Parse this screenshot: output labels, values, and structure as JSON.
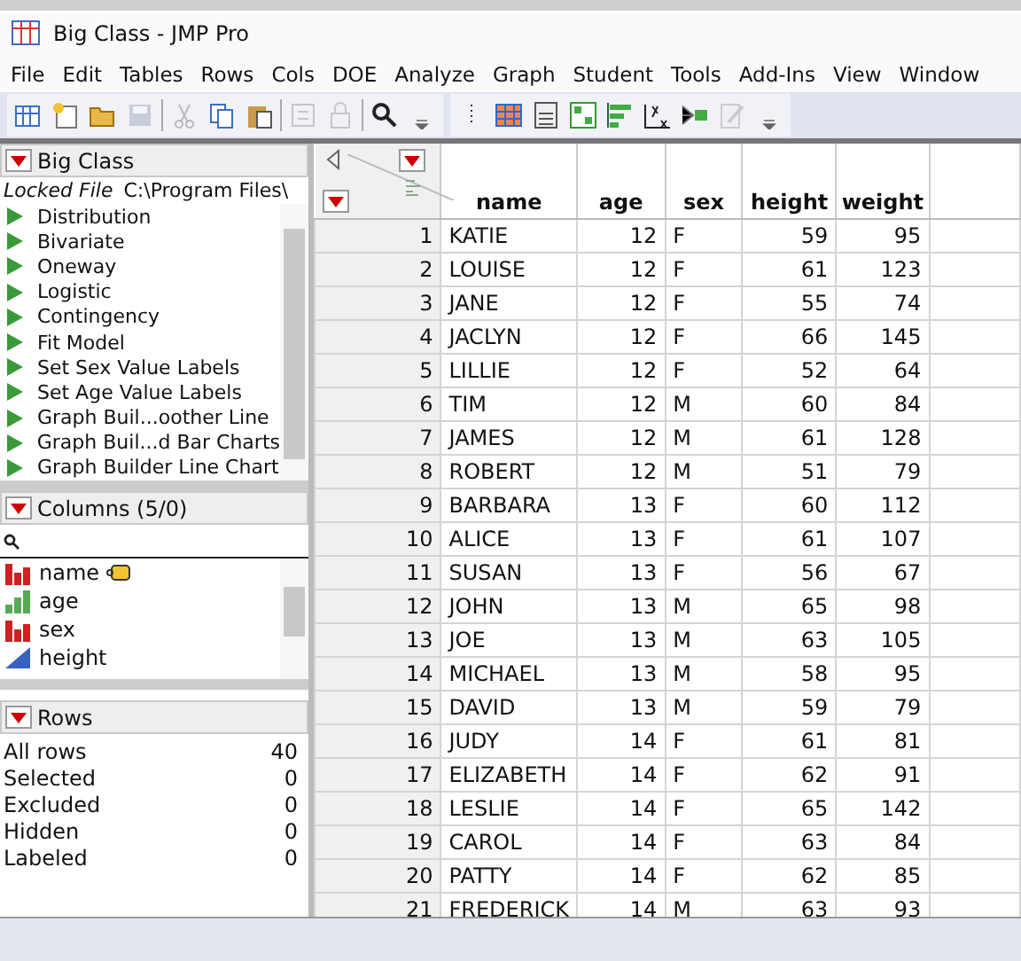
{
  "window": {
    "title": "Big Class - JMP Pro"
  },
  "menu": [
    "File",
    "Edit",
    "Tables",
    "Rows",
    "Cols",
    "DOE",
    "Analyze",
    "Graph",
    "Student",
    "Tools",
    "Add-Ins",
    "View",
    "Window"
  ],
  "toolbar": [
    {
      "kind": "new-table",
      "disabled": false
    },
    {
      "kind": "new-script",
      "disabled": false
    },
    {
      "kind": "open",
      "disabled": false
    },
    {
      "kind": "save",
      "disabled": true
    },
    {
      "kind": "sep"
    },
    {
      "kind": "cut",
      "disabled": true
    },
    {
      "kind": "copy",
      "disabled": false
    },
    {
      "kind": "paste",
      "disabled": false
    },
    {
      "kind": "sep"
    },
    {
      "kind": "settings",
      "disabled": true
    },
    {
      "kind": "lock",
      "disabled": true
    },
    {
      "kind": "sep"
    },
    {
      "kind": "search",
      "disabled": false
    },
    {
      "kind": "more",
      "disabled": false
    },
    {
      "kind": "grip"
    },
    {
      "kind": "data-table",
      "disabled": false
    },
    {
      "kind": "calculator",
      "disabled": false
    },
    {
      "kind": "grid",
      "disabled": false
    },
    {
      "kind": "bars",
      "disabled": false
    },
    {
      "kind": "formula",
      "disabled": false
    },
    {
      "kind": "tree",
      "disabled": false
    },
    {
      "kind": "edit",
      "disabled": true
    },
    {
      "kind": "more",
      "disabled": false
    }
  ],
  "table_panel": {
    "title": "Big Class",
    "locked_label": "Locked File",
    "path": "C:\\Program Files\\",
    "scripts": [
      "Distribution",
      "Bivariate",
      "Oneway",
      "Logistic",
      "Contingency",
      "Fit Model",
      "Set Sex Value Labels",
      "Set Age Value Labels",
      "Graph Buil...oother Line",
      "Graph Buil...d Bar Charts",
      "Graph Builder Line Chart"
    ]
  },
  "columns_panel": {
    "title": "Columns (5/0)",
    "columns": [
      {
        "name": "name",
        "kind": "nominal",
        "label_tag": true
      },
      {
        "name": "age",
        "kind": "ordinal",
        "label_tag": false
      },
      {
        "name": "sex",
        "kind": "nominal",
        "label_tag": false
      },
      {
        "name": "height",
        "kind": "continuous",
        "label_tag": false
      }
    ]
  },
  "rows_panel": {
    "title": "Rows",
    "stats": [
      {
        "label": "All rows",
        "value": "40"
      },
      {
        "label": "Selected",
        "value": "0"
      },
      {
        "label": "Excluded",
        "value": "0"
      },
      {
        "label": "Hidden",
        "value": "0"
      },
      {
        "label": "Labeled",
        "value": "0"
      }
    ]
  },
  "table": {
    "columns": [
      "",
      "name",
      "age",
      "sex",
      "height",
      "weight"
    ],
    "rows": [
      [
        "1",
        "KATIE",
        "12",
        "F",
        "59",
        "95"
      ],
      [
        "2",
        "LOUISE",
        "12",
        "F",
        "61",
        "123"
      ],
      [
        "3",
        "JANE",
        "12",
        "F",
        "55",
        "74"
      ],
      [
        "4",
        "JACLYN",
        "12",
        "F",
        "66",
        "145"
      ],
      [
        "5",
        "LILLIE",
        "12",
        "F",
        "52",
        "64"
      ],
      [
        "6",
        "TIM",
        "12",
        "M",
        "60",
        "84"
      ],
      [
        "7",
        "JAMES",
        "12",
        "M",
        "61",
        "128"
      ],
      [
        "8",
        "ROBERT",
        "12",
        "M",
        "51",
        "79"
      ],
      [
        "9",
        "BARBARA",
        "13",
        "F",
        "60",
        "112"
      ],
      [
        "10",
        "ALICE",
        "13",
        "F",
        "61",
        "107"
      ],
      [
        "11",
        "SUSAN",
        "13",
        "F",
        "56",
        "67"
      ],
      [
        "12",
        "JOHN",
        "13",
        "M",
        "65",
        "98"
      ],
      [
        "13",
        "JOE",
        "13",
        "M",
        "63",
        "105"
      ],
      [
        "14",
        "MICHAEL",
        "13",
        "M",
        "58",
        "95"
      ],
      [
        "15",
        "DAVID",
        "13",
        "M",
        "59",
        "79"
      ],
      [
        "16",
        "JUDY",
        "14",
        "F",
        "61",
        "81"
      ],
      [
        "17",
        "ELIZABETH",
        "14",
        "F",
        "62",
        "91"
      ],
      [
        "18",
        "LESLIE",
        "14",
        "F",
        "65",
        "142"
      ],
      [
        "19",
        "CAROL",
        "14",
        "F",
        "63",
        "84"
      ],
      [
        "20",
        "PATTY",
        "14",
        "F",
        "62",
        "85"
      ],
      [
        "21",
        "FREDERICK",
        "14",
        "M",
        "63",
        "93"
      ]
    ]
  }
}
